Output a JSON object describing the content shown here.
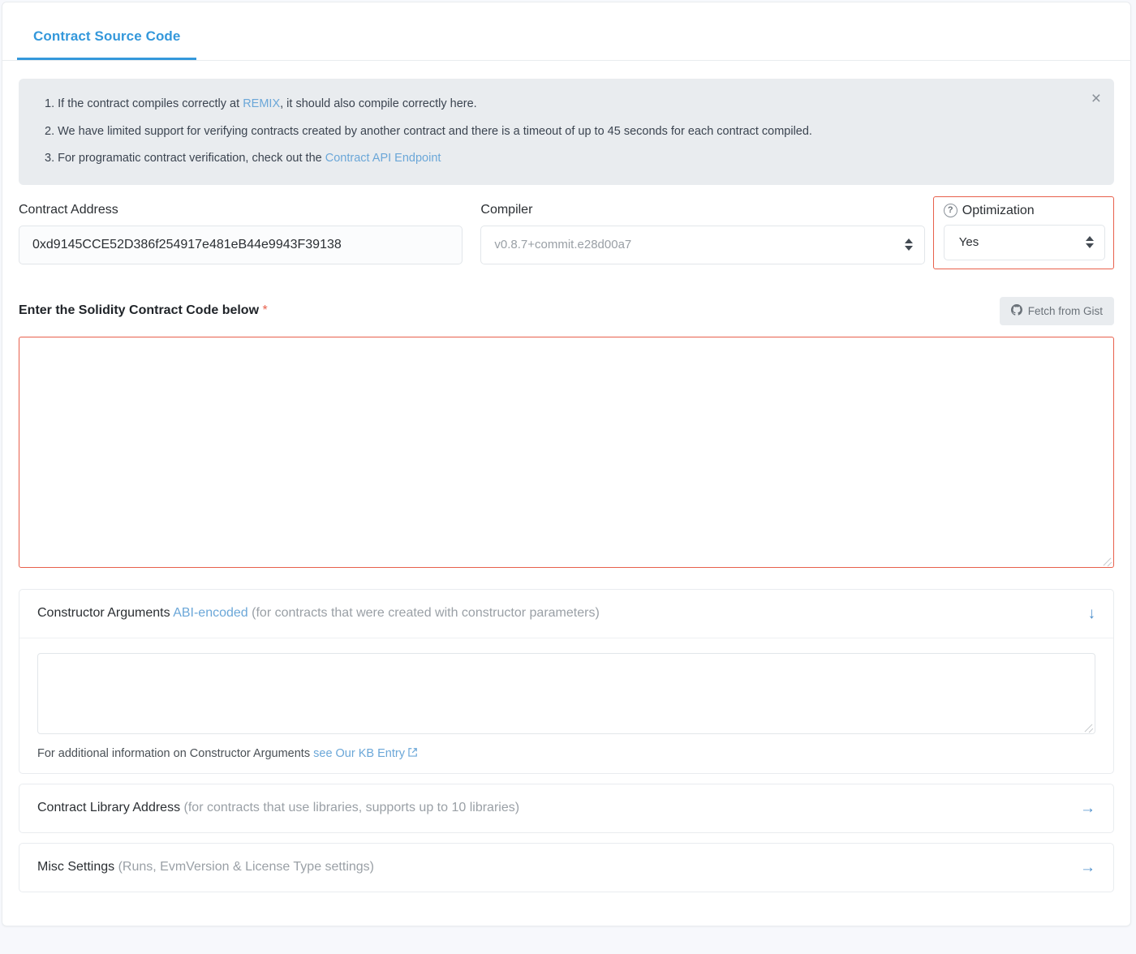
{
  "tabs": [
    {
      "label": "Contract Source Code",
      "active": true
    }
  ],
  "notice": {
    "close_label": "×",
    "lines": [
      {
        "num": "1. ",
        "pre": "If the contract compiles correctly at ",
        "link": "REMIX",
        "post": ", it should also compile correctly here."
      },
      {
        "num": "2. ",
        "pre": "We have limited support for verifying contracts created by another contract and there is a timeout of up to 45 seconds for each contract compiled.",
        "link": "",
        "post": ""
      },
      {
        "num": "3. ",
        "pre": "For programatic contract verification, check out the ",
        "link": "Contract API Endpoint",
        "post": ""
      }
    ]
  },
  "form": {
    "contract_address": {
      "label": "Contract Address",
      "value": "0xd9145CCE52D386f254917e481eB44e9943F39138"
    },
    "compiler": {
      "label": "Compiler",
      "value": "v0.8.7+commit.e28d00a7"
    },
    "optimization": {
      "label": "Optimization",
      "help_icon": "question-circle-icon",
      "value": "Yes",
      "highlight_color": "#e8604c"
    }
  },
  "code_section": {
    "label": "Enter the Solidity Contract Code below",
    "required_marker": "*",
    "gist_button": "Fetch from Gist",
    "gist_icon": "github-icon",
    "textarea_value": "",
    "border_color": "#e8604c"
  },
  "panels": [
    {
      "title": "Constructor Arguments",
      "link": "ABI-encoded",
      "hint": "(for contracts that were created with constructor parameters)",
      "arrow": "↓",
      "arrow_icon": "arrow-down-icon",
      "expanded": true,
      "body": {
        "textarea_value": "",
        "note_pre": "For additional information on Constructor Arguments ",
        "note_link": "see Our KB Entry",
        "note_icon": "external-link-icon"
      }
    },
    {
      "title": "Contract Library Address",
      "link": "",
      "hint": "(for contracts that use libraries, supports up to 10 libraries)",
      "arrow": "→",
      "arrow_icon": "arrow-right-icon",
      "expanded": false
    },
    {
      "title": "Misc Settings",
      "link": "",
      "hint": "(Runs, EvmVersion & License Type settings)",
      "arrow": "→",
      "arrow_icon": "arrow-right-icon",
      "expanded": false
    }
  ]
}
